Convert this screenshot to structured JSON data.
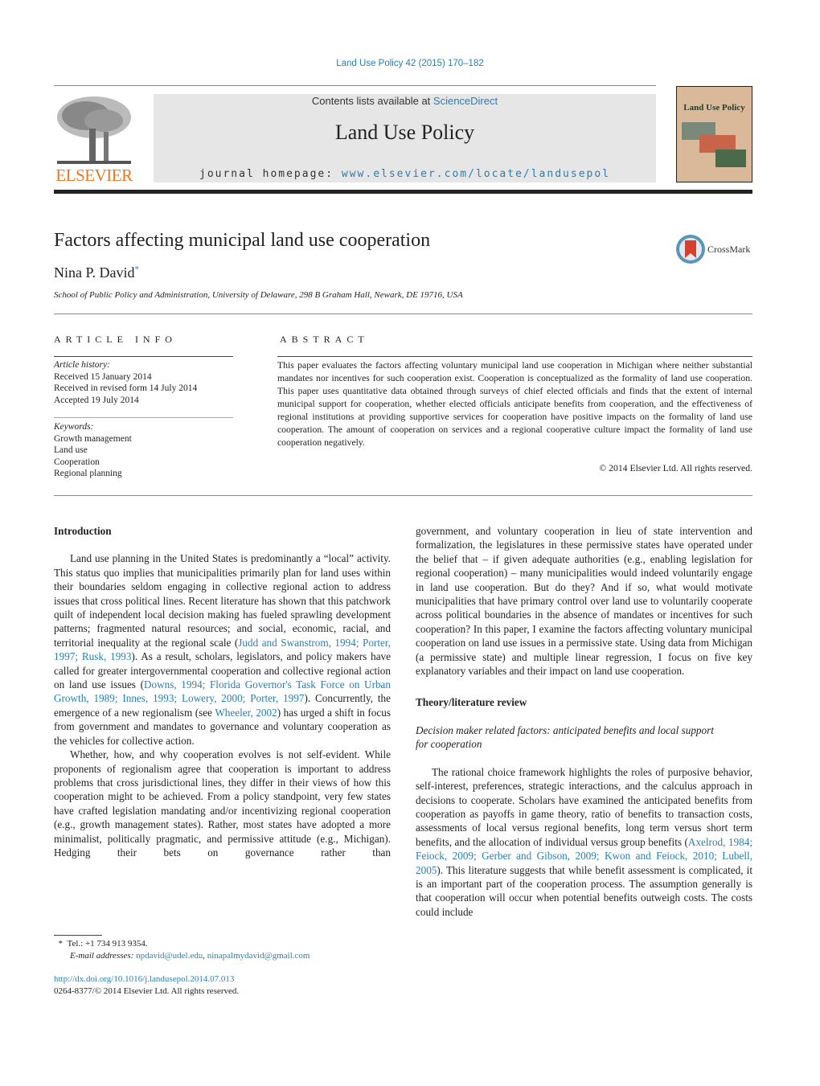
{
  "header": {
    "citation": "Land Use Policy 42 (2015) 170–182",
    "contents_prefix": "Contents lists available at ",
    "contents_link": "ScienceDirect",
    "journal_title": "Land Use Policy",
    "homepage_prefix": "journal homepage: ",
    "homepage_link": "www.elsevier.com/locate/landusepol",
    "publisher_logo_text": "ELSEVIER",
    "cover_title": "Land Use Policy",
    "crossmark_label": "CrossMark"
  },
  "article": {
    "title": "Factors affecting municipal land use cooperation",
    "author": "Nina P. David",
    "author_mark": "*",
    "affiliation": "School of Public Policy and Administration, University of Delaware, 298 B Graham Hall, Newark, DE 19716, USA"
  },
  "article_info": {
    "heading": "ARTICLE INFO",
    "history_label": "Article history:",
    "history": [
      "Received 15 January 2014",
      "Received in revised form 14 July 2014",
      "Accepted 19 July 2014"
    ],
    "keywords_label": "Keywords:",
    "keywords": [
      "Growth management",
      "Land use",
      "Cooperation",
      "Regional planning"
    ]
  },
  "abstract": {
    "heading": "ABSTRACT",
    "text": "This paper evaluates the factors affecting voluntary municipal land use cooperation in Michigan where neither substantial mandates nor incentives for such cooperation exist. Cooperation is conceptualized as the formality of land use cooperation. This paper uses quantitative data obtained through surveys of chief elected officials and finds that the extent of internal municipal support for cooperation, whether elected officials anticipate benefits from cooperation, and the effectiveness of regional institutions at providing supportive services for cooperation have positive impacts on the formality of land use cooperation. The amount of cooperation on services and a regional cooperative culture impact the formality of land use cooperation negatively.",
    "copyright": "© 2014 Elsevier Ltd. All rights reserved."
  },
  "body": {
    "intro_heading": "Introduction",
    "p1_a": "Land use planning in the United States is predominantly a “local” activity. This status quo implies that municipalities primarily plan for land uses within their boundaries seldom engaging in collective regional action to address issues that cross political lines. Recent literature has shown that this patchwork quilt of independent local decision making has fueled sprawling development patterns; fragmented natural resources; and social, economic, racial, and territorial inequality at the regional scale (",
    "p1_ref1": "Judd and Swanstrom, 1994; Porter, 1997; Rusk, 1993",
    "p1_b": "). As a result, scholars, legislators, and policy makers have called for greater intergovernmental cooperation and collective regional action on land use issues (",
    "p1_ref2": "Downs, 1994; Florida Governor's Task Force on Urban Growth, 1989; Innes, 1993; Lowery, 2000; Porter, 1997",
    "p1_c": "). Concurrently, the emergence of a new regionalism (see ",
    "p1_ref3": "Wheeler, 2002",
    "p1_d": ") has urged a shift in focus from government and mandates to governance and voluntary cooperation as the vehicles for collective action.",
    "p2": "Whether, how, and why cooperation evolves is not self-evident. While proponents of regionalism agree that cooperation is important to address problems that cross jurisdictional lines, they differ in their views of how this cooperation might to be achieved. From a policy standpoint, very few states have crafted legislation mandating and/or incentivizing regional cooperation (e.g., growth management states). Rather, most states have adopted a more minimalist, politically pragmatic, and permissive attitude (e.g., Michigan). Hedging their bets on governance rather than",
    "p2_cont": "government, and voluntary cooperation in lieu of state intervention and formalization, the legislatures in these permissive states have operated under the belief that – if given adequate authorities (e.g., enabling legislation for regional cooperation) – many municipalities would indeed voluntarily engage in land use cooperation. But do they? And if so, what would motivate municipalities that have primary control over land use to voluntarily cooperate across political boundaries in the absence of mandates or incentives for such cooperation? In this paper, I examine the factors affecting voluntary municipal cooperation on land use issues in a permissive state. Using data from Michigan (a permissive state) and multiple linear regression, I focus on five key explanatory variables and their impact on land use cooperation.",
    "theory_heading": "Theory/literature review",
    "subsection_heading": "Decision maker related factors: anticipated benefits and local support for cooperation",
    "p3_a": "The rational choice framework highlights the roles of purposive behavior, self-interest, preferences, strategic interactions, and the calculus approach in decisions to cooperate. Scholars have examined the anticipated benefits from cooperation as payoffs in game theory, ratio of benefits to transaction costs, assessments of local versus regional benefits, long term versus short term benefits, and the allocation of individual versus group benefits (",
    "p3_ref": "Axelrod, 1984; Feiock, 2009; Gerber and Gibson, 2009; Kwon and Feiock, 2010; Lubell, 2005",
    "p3_b": "). This literature suggests that while benefit assessment is complicated, it is an important part of the cooperation process. The assumption generally is that cooperation will occur when potential benefits outweigh costs. The costs could include"
  },
  "footnote": {
    "mark": "*",
    "tel": "Tel.: +1 734 913 9354.",
    "email_label": "E-mail addresses:",
    "email1": "npdavid@udel.edu",
    "email2": "ninapalmydavid@gmail.com",
    "doi": "http://dx.doi.org/10.1016/j.landusepol.2014.07.013",
    "issn": "0264-8377/© 2014 Elsevier Ltd. All rights reserved."
  }
}
